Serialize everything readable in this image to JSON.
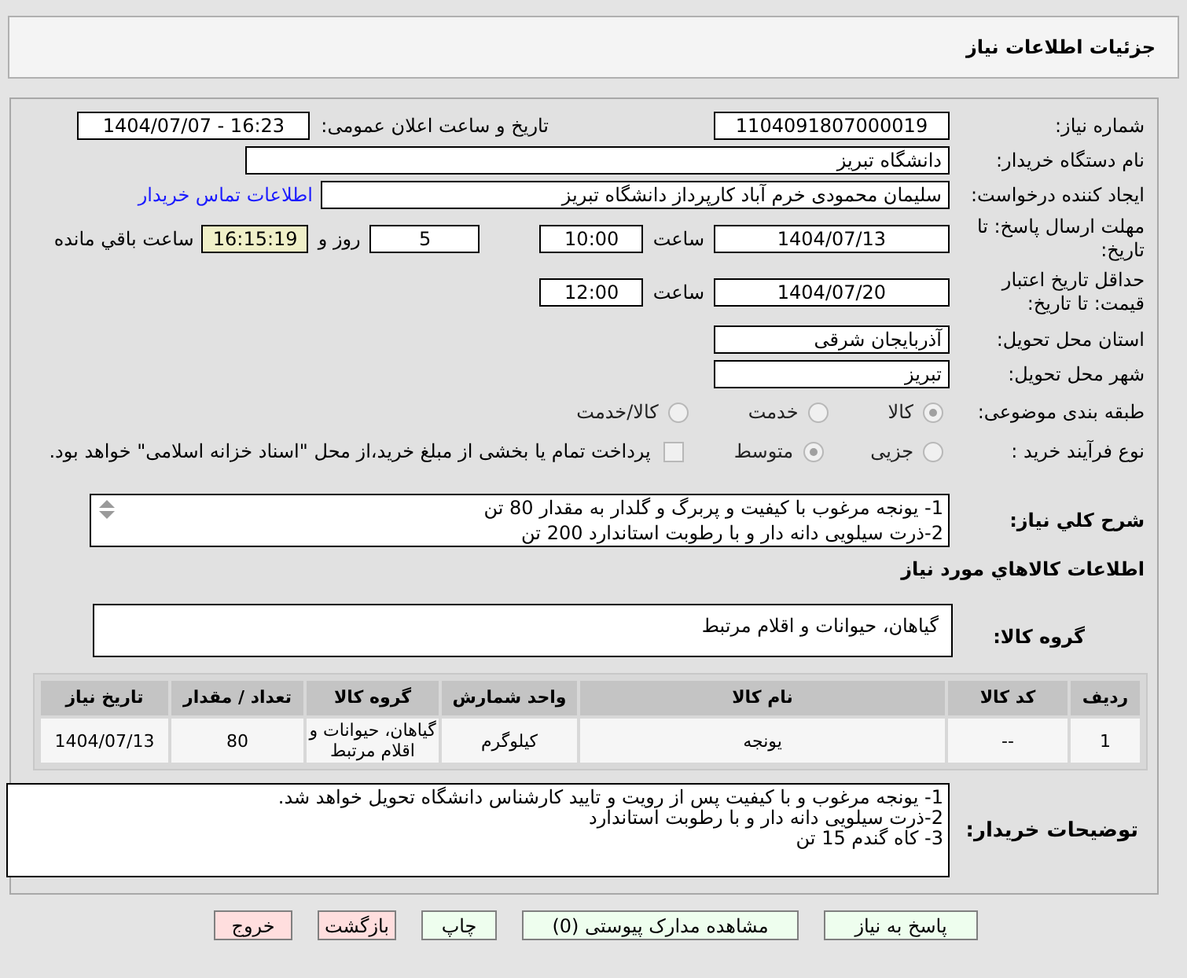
{
  "header": {
    "title": "جزئیات اطلاعات نیاز"
  },
  "need_number": {
    "label": "شماره نیاز:",
    "value": "1104091807000019"
  },
  "announce_datetime": {
    "label": "تاریخ و ساعت اعلان عمومی:",
    "value": "1404/07/07 - 16:23"
  },
  "buyer_org": {
    "label": "نام دستگاه خریدار:",
    "value": "دانشگاه تبریز"
  },
  "requester": {
    "label": "ایجاد کننده درخواست:",
    "value": "سلیمان محمودی خرم آباد کارپرداز دانشگاه تبریز",
    "link": "اطلاعات تماس خریدار"
  },
  "reply_deadline": {
    "label": "مهلت ارسال پاسخ: تا تاریخ:",
    "date": "1404/07/13",
    "time_label": "ساعت",
    "time": "10:00",
    "days": "5",
    "days_label": "روز و",
    "remaining": "16:15:19",
    "remaining_label": "ساعت باقي مانده"
  },
  "price_validity": {
    "label": "حداقل تاریخ اعتبار قیمت: تا تاریخ:",
    "date": "1404/07/20",
    "time_label": "ساعت",
    "time": "12:00"
  },
  "province": {
    "label": "استان محل تحویل:",
    "value": "آذربایجان شرقی"
  },
  "city": {
    "label": "شهر محل تحویل:",
    "value": "تبریز"
  },
  "category": {
    "label": "طبقه بندی موضوعی:",
    "options": [
      {
        "label": "کالا",
        "selected": true
      },
      {
        "label": "خدمت",
        "selected": false
      },
      {
        "label": "کالا/خدمت",
        "selected": false
      }
    ]
  },
  "process": {
    "label": "نوع فرآیند خرید :",
    "options": [
      {
        "label": "جزیی",
        "selected": false
      },
      {
        "label": "متوسط",
        "selected": true
      }
    ],
    "treasury": {
      "label": "پرداخت تمام یا بخشی از مبلغ خرید،از محل \"اسناد خزانه اسلامی\" خواهد بود.",
      "checked": false
    }
  },
  "description": {
    "label": "شرح کلي نياز:",
    "lines": [
      "1- یونجه مرغوب با کیفیت و پربرگ و گلدار به مقدار 80 تن",
      "2-ذرت سیلویی دانه دار و با رطوبت استاندارد 200 تن"
    ]
  },
  "goods_title": "اطلاعات کالاهاي مورد نياز",
  "goods_group": {
    "label": "گروه کالا:",
    "value": "گیاهان، حیوانات و اقلام مرتبط"
  },
  "table": {
    "columns": [
      "ردیف",
      "کد کالا",
      "نام کالا",
      "واحد شمارش",
      "گروه کالا",
      "تعداد / مقدار",
      "تاریخ نیاز"
    ],
    "rows": [
      [
        "1",
        "--",
        "یونجه",
        "کیلوگرم",
        "گیاهان، حیوانات و اقلام مرتبط",
        "80",
        "1404/07/13"
      ]
    ]
  },
  "buyer_notes": {
    "label": "توضیحات خریدار:",
    "lines": [
      "1- یونجه مرغوب و با کیفیت پس از رویت و تایید کارشناس دانشگاه تحویل خواهد شد.",
      "2-ذرت سیلویی دانه دار و با رطوبت استاندارد",
      "3- کاه گندم 15 تن"
    ]
  },
  "buttons": [
    {
      "label": "پاسخ به نیاز",
      "kind": "go"
    },
    {
      "label": "مشاهده مدارک پیوستی (0)",
      "kind": "go"
    },
    {
      "label": "چاپ",
      "kind": "go"
    },
    {
      "label": "بازگشت",
      "kind": "back"
    },
    {
      "label": "خروج",
      "kind": "back"
    }
  ]
}
